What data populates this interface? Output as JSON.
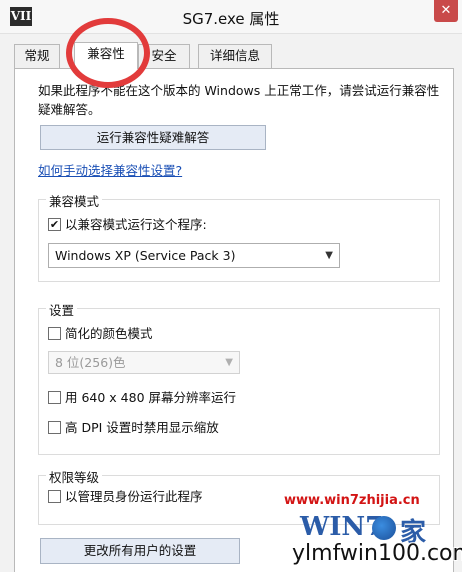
{
  "window": {
    "icon_text": "VII",
    "title": "SG7.exe 属性",
    "close_glyph": "✕"
  },
  "tabs": [
    {
      "label": "常规",
      "active": false
    },
    {
      "label": "兼容性",
      "active": true
    },
    {
      "label": "安全",
      "active": false
    },
    {
      "label": "详细信息",
      "active": false
    }
  ],
  "compat": {
    "description": "如果此程序不能在这个版本的 Windows 上正常工作，请尝试运行兼容性疑难解答。",
    "troubleshoot_button": "运行兼容性疑难解答",
    "manual_link": "如何手动选择兼容性设置?",
    "mode_group_title": "兼容模式",
    "mode_checkbox_label": "以兼容模式运行这个程序:",
    "mode_checked": "✔",
    "os_selected": "Windows XP (Service Pack 3)",
    "dropdown_glyph": "▼"
  },
  "settings": {
    "group_title": "设置",
    "reduced_color_label": "简化的颜色模式",
    "color_selected": "8 位(256)色",
    "res_640_label": "用 640 x 480 屏幕分辨率运行",
    "high_dpi_label": "高 DPI 设置时禁用显示缩放"
  },
  "privilege": {
    "group_title": "权限等级",
    "admin_label": "以管理员身份运行此程序"
  },
  "all_users_button": "更改所有用户的设置",
  "watermarks": {
    "url": "www.win7zhijia.cn",
    "logo_text": "WIN7",
    "logo_suffix": "家",
    "site": "ylmfwin100.com"
  },
  "colors": {
    "highlight": "#e23b3b",
    "link": "#1a4fb5",
    "button_bg": "#e5ebf5",
    "close_button": "#c94a4a"
  }
}
